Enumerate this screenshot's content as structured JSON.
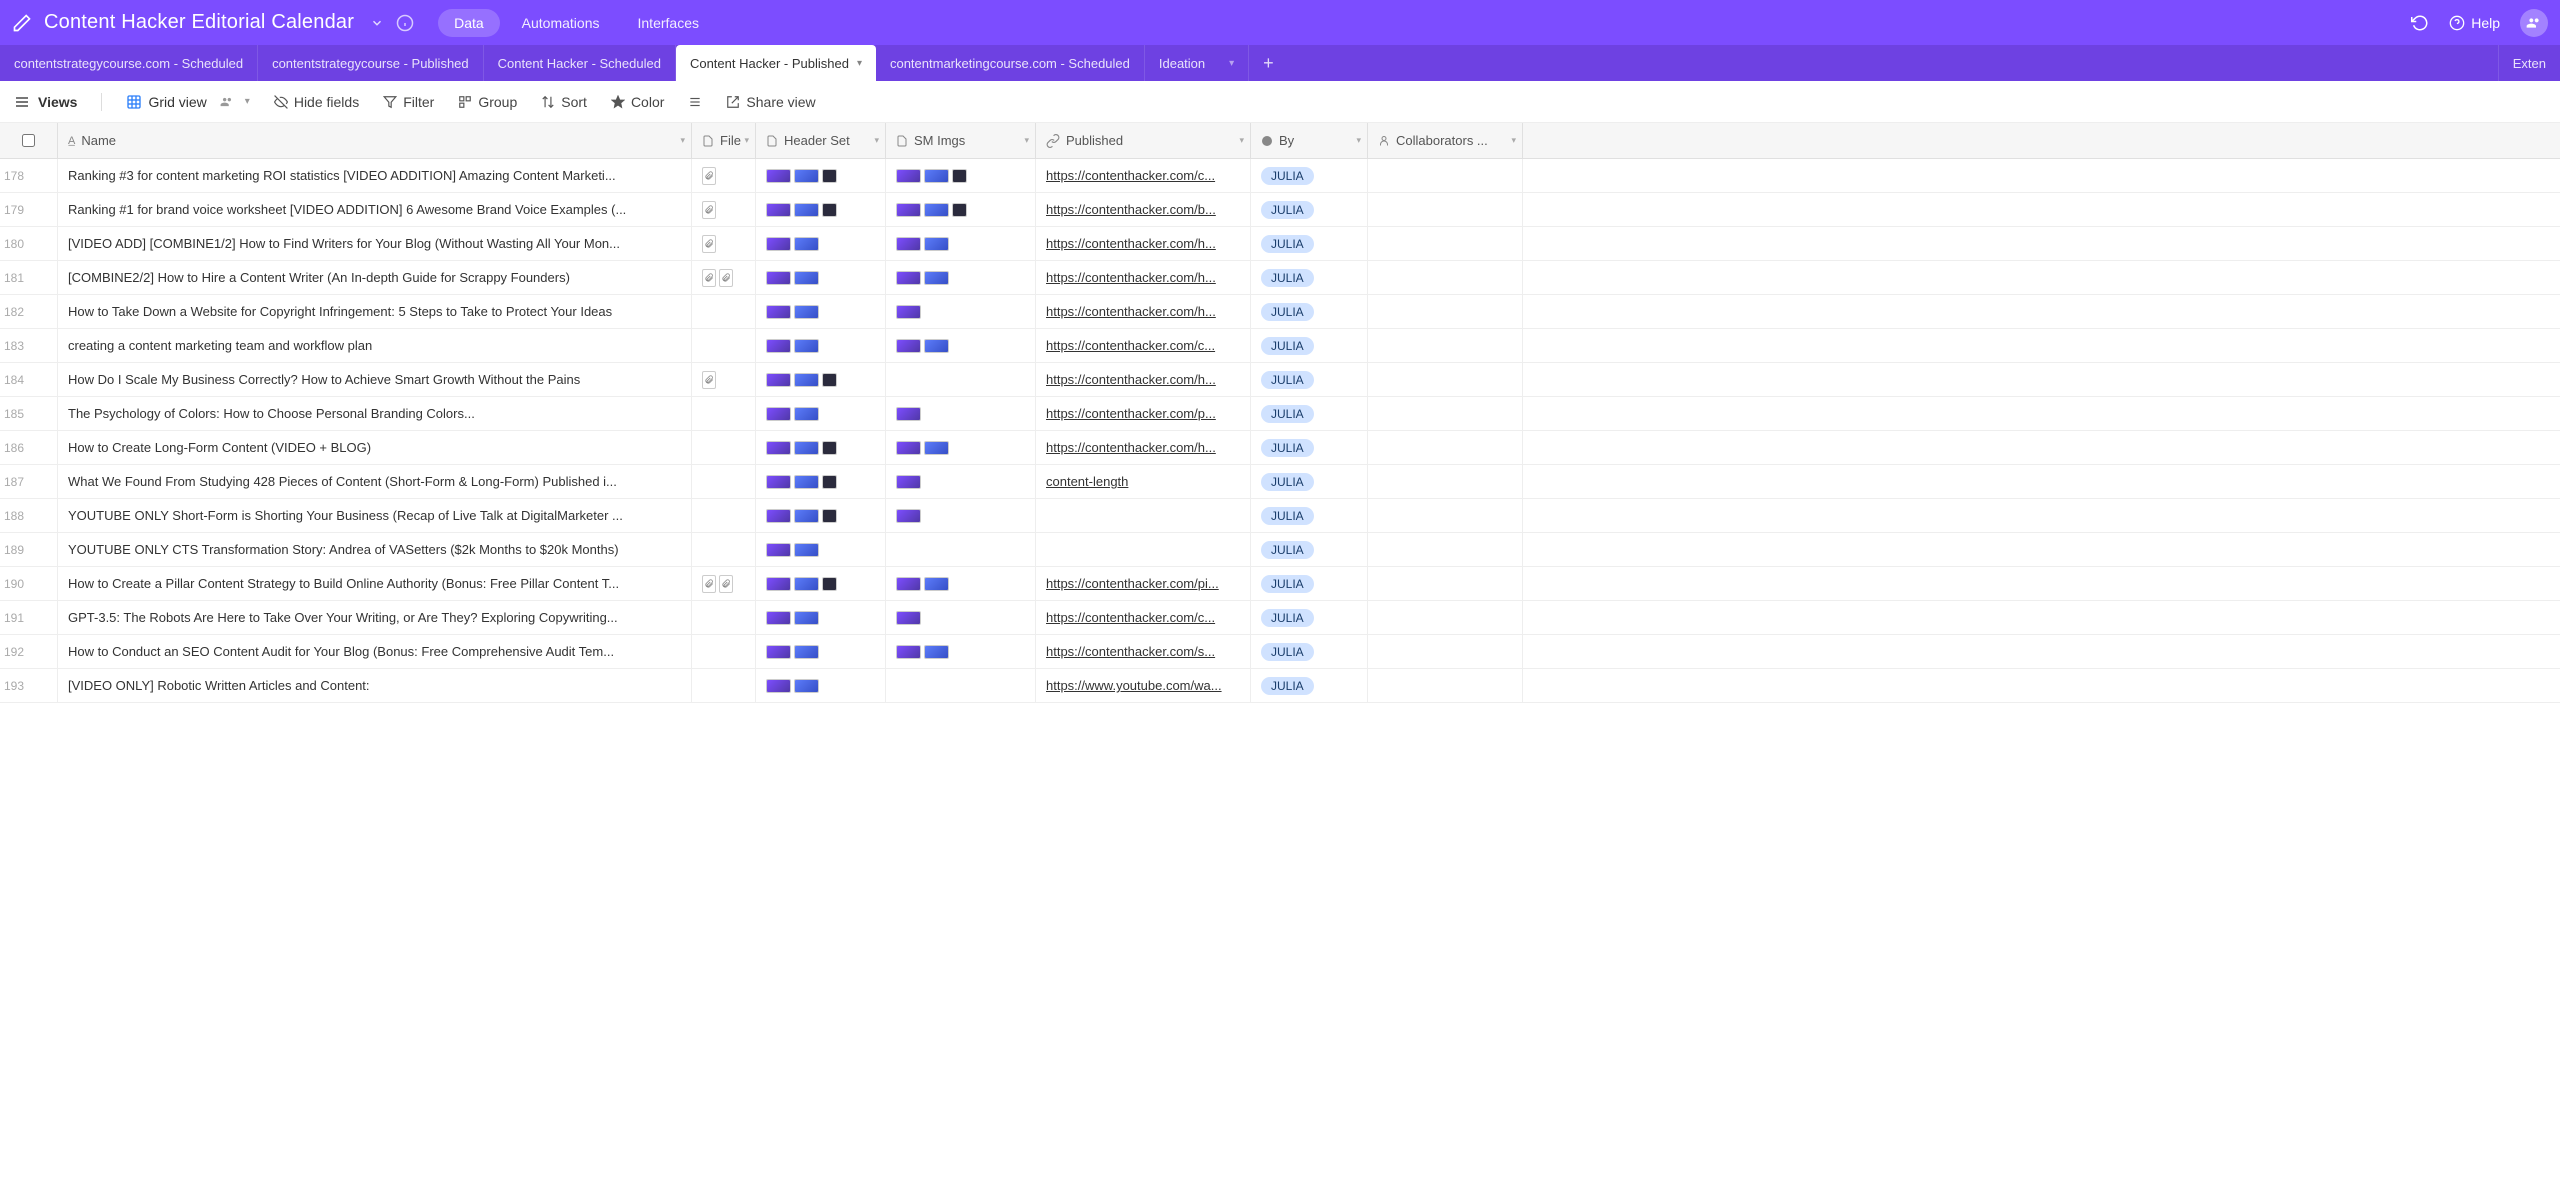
{
  "header": {
    "title": "Content Hacker Editorial Calendar",
    "nav": [
      "Data",
      "Automations",
      "Interfaces"
    ],
    "active_nav": 0,
    "help_label": "Help"
  },
  "tabs": {
    "items": [
      "contentstrategycourse.com - Scheduled",
      "contentstrategycourse - Published",
      "Content Hacker - Scheduled",
      "Content Hacker - Published",
      "contentmarketingcourse.com - Scheduled",
      "Ideation"
    ],
    "active": 3,
    "extensions_label": "Exten"
  },
  "toolbar": {
    "views": "Views",
    "gridview": "Grid view",
    "hide_fields": "Hide fields",
    "filter": "Filter",
    "group": "Group",
    "sort": "Sort",
    "color": "Color",
    "share": "Share view"
  },
  "columns": {
    "name": "Name",
    "file": "File",
    "header_set": "Header Set",
    "sm_imgs": "SM Imgs",
    "published": "Published",
    "by": "By",
    "collaborators": "Collaborators ..."
  },
  "rows": [
    {
      "num": "178",
      "name": "Ranking #3 for content marketing ROI statistics [VIDEO ADDITION] Amazing Content Marketi...",
      "file": 1,
      "header": 3,
      "sm": 3,
      "pub": "https://contenthacker.com/c...",
      "by": "JULIA"
    },
    {
      "num": "179",
      "name": "Ranking #1 for brand voice worksheet [VIDEO ADDITION] 6 Awesome Brand Voice Examples (...",
      "file": 1,
      "header": 3,
      "sm": 3,
      "pub": "https://contenthacker.com/b...",
      "by": "JULIA"
    },
    {
      "num": "180",
      "name": "[VIDEO ADD] [COMBINE1/2] How to Find Writers for Your Blog (Without Wasting All Your Mon...",
      "file": 1,
      "header": 2,
      "sm": 2,
      "pub": "https://contenthacker.com/h...",
      "by": "JULIA"
    },
    {
      "num": "181",
      "name": "[COMBINE2/2] How to Hire a Content Writer (An In-depth Guide for Scrappy Founders)",
      "file": 2,
      "header": 2,
      "sm": 2,
      "pub": "https://contenthacker.com/h...",
      "by": "JULIA"
    },
    {
      "num": "182",
      "name": "How to Take Down a Website for Copyright Infringement: 5 Steps to Take to Protect Your Ideas",
      "file": 0,
      "header": 2,
      "sm": 1,
      "pub": "https://contenthacker.com/h...",
      "by": "JULIA"
    },
    {
      "num": "183",
      "name": "creating a content marketing team and workflow plan",
      "file": 0,
      "header": 2,
      "sm": 2,
      "pub": "https://contenthacker.com/c...",
      "by": "JULIA"
    },
    {
      "num": "184",
      "name": "How Do I Scale My Business Correctly? How to Achieve Smart Growth Without the Pains",
      "file": 1,
      "header": 3,
      "sm": 0,
      "pub": "https://contenthacker.com/h...",
      "by": "JULIA"
    },
    {
      "num": "185",
      "name": "The Psychology of Colors: How to Choose Personal Branding Colors...",
      "file": 0,
      "header": 2,
      "sm": 1,
      "pub": "https://contenthacker.com/p...",
      "by": "JULIA"
    },
    {
      "num": "186",
      "name": "How to Create Long-Form Content (VIDEO + BLOG)",
      "file": 0,
      "header": 3,
      "sm": 2,
      "pub": "https://contenthacker.com/h...",
      "by": "JULIA"
    },
    {
      "num": "187",
      "name": "What We Found From Studying 428 Pieces of Content (Short-Form & Long-Form) Published i...",
      "file": 0,
      "header": 3,
      "sm": 1,
      "pub": "content-length",
      "by": "JULIA"
    },
    {
      "num": "188",
      "name": "YOUTUBE ONLY Short-Form is Shorting Your Business (Recap of Live Talk at DigitalMarketer ...",
      "file": 0,
      "header": 3,
      "sm": 1,
      "pub": "",
      "by": "JULIA"
    },
    {
      "num": "189",
      "name": "YOUTUBE ONLY CTS Transformation Story: Andrea of VASetters ($2k Months to $20k Months)",
      "file": 0,
      "header": 2,
      "sm": 0,
      "pub": "",
      "by": "JULIA"
    },
    {
      "num": "190",
      "name": "How to Create a Pillar Content Strategy to Build Online Authority (Bonus: Free Pillar Content T...",
      "file": 2,
      "header": 3,
      "sm": 2,
      "pub": "https://contenthacker.com/pi...",
      "by": "JULIA"
    },
    {
      "num": "191",
      "name": "GPT-3.5: The Robots Are Here to Take Over Your Writing, or Are They? Exploring Copywriting...",
      "file": 0,
      "header": 2,
      "sm": 1,
      "pub": "https://contenthacker.com/c...",
      "by": "JULIA"
    },
    {
      "num": "192",
      "name": "How to Conduct an SEO Content Audit for Your Blog (Bonus: Free Comprehensive Audit Tem...",
      "file": 0,
      "header": 2,
      "sm": 2,
      "pub": "https://contenthacker.com/s...",
      "by": "JULIA"
    },
    {
      "num": "193",
      "name": "[VIDEO ONLY] Robotic Written Articles and Content:",
      "file": 0,
      "header": 2,
      "sm": 0,
      "pub": "https://www.youtube.com/wa...",
      "by": "JULIA"
    }
  ]
}
